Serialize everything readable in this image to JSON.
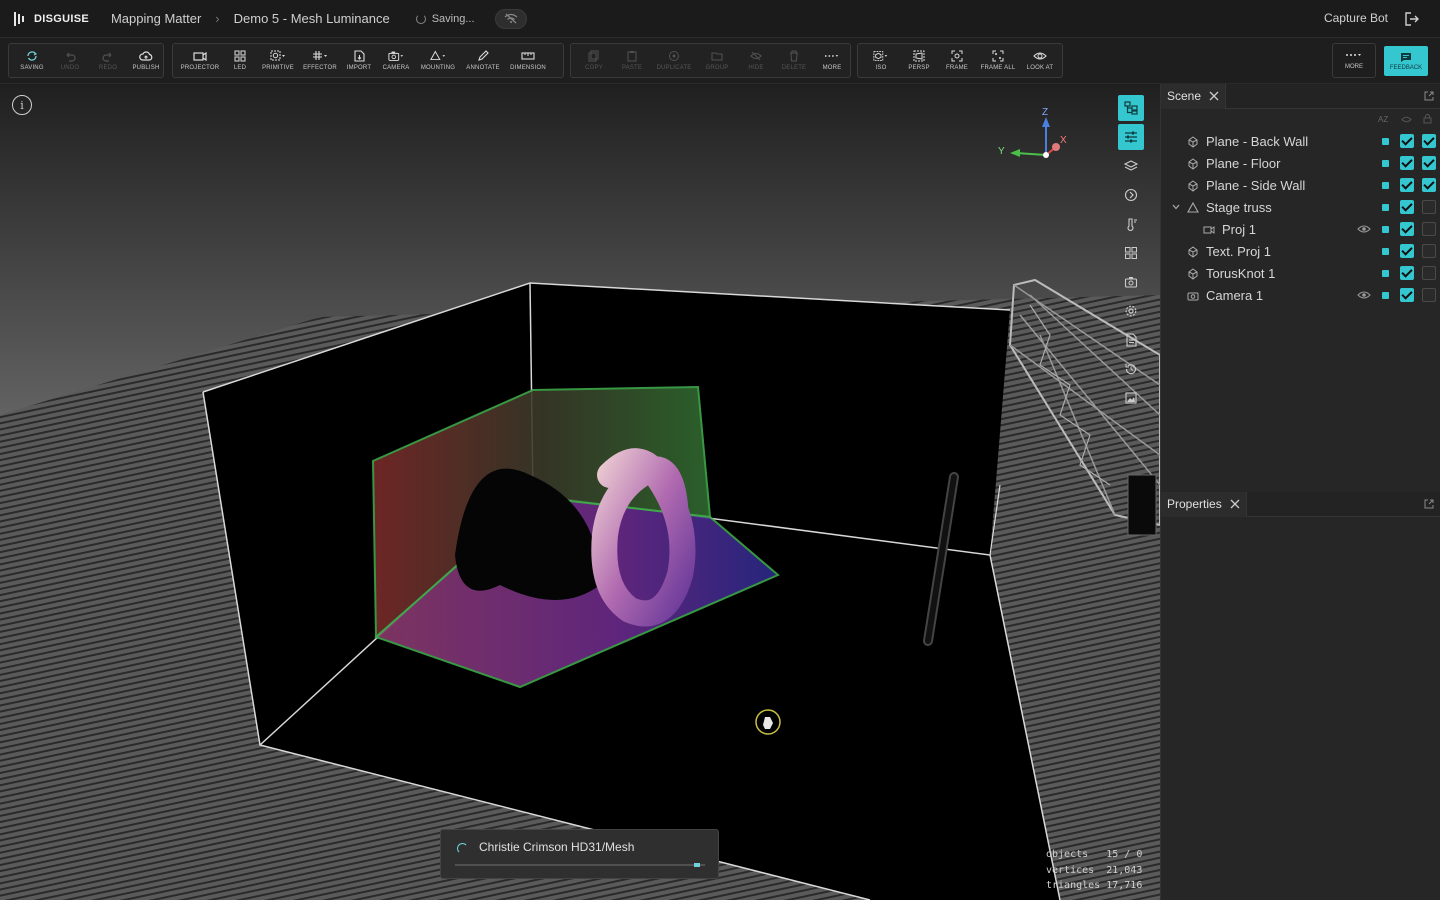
{
  "app": {
    "brand": "DISGUISE",
    "breadcrumbs": [
      "Mapping Matter",
      "Demo 5 - Mesh Luminance"
    ],
    "status": "Saving...",
    "user": "Capture Bot"
  },
  "toolbar": {
    "group1": [
      "SAVING",
      "UNDO",
      "REDO",
      "PUBLISH"
    ],
    "group2": [
      "PROJECTOR",
      "LED",
      "PRIMITIVE",
      "EFFECTOR",
      "IMPORT",
      "CAMERA",
      "MOUNTING",
      "ANNOTATE",
      "DIMENSION"
    ],
    "group3": [
      "COPY",
      "PASTE",
      "DUPLICATE",
      "GROUP",
      "HIDE",
      "DELETE",
      "MORE"
    ],
    "group4": [
      "ISO",
      "PERSP",
      "FRAME",
      "FRAME ALL",
      "LOOK AT"
    ],
    "more": "MORE",
    "feedback": "FEEDBACK"
  },
  "viewport": {
    "gizmo": {
      "z": "Z",
      "x": "X",
      "y": "Y"
    },
    "loading": {
      "label": "Christie Crimson HD31/Mesh",
      "progress": 0.98
    },
    "stats": {
      "objects_label": "objects",
      "objects_value": "15 / 0",
      "vertices_label": "vertices",
      "vertices_value": "21,043",
      "triangles_label": "triangles",
      "triangles_value": "17,716"
    }
  },
  "scene_panel": {
    "title": "Scene",
    "sort_label": "AZ",
    "items": [
      {
        "label": "Plane - Back Wall",
        "icon": "mesh-icon",
        "visible": true,
        "locked": true
      },
      {
        "label": "Plane - Floor",
        "icon": "mesh-icon",
        "visible": true,
        "locked": true
      },
      {
        "label": "Plane - Side Wall",
        "icon": "mesh-icon",
        "visible": true,
        "locked": true
      },
      {
        "label": "Stage truss",
        "icon": "mounting-icon",
        "visible": true,
        "locked": false
      },
      {
        "label": "Proj 1",
        "icon": "projector-icon",
        "visible": true,
        "locked": false
      },
      {
        "label": "Text. Proj 1",
        "icon": "mesh-icon",
        "visible": true,
        "locked": false
      },
      {
        "label": "TorusKnot 1",
        "icon": "mesh-icon",
        "visible": true,
        "locked": false
      },
      {
        "label": "Camera 1",
        "icon": "camera-icon",
        "visible": true,
        "locked": false
      }
    ]
  },
  "properties_panel": {
    "title": "Properties"
  },
  "colors": {
    "accent": "#35c7cf",
    "bg": "#1e1e1e",
    "panel": "#262626"
  }
}
